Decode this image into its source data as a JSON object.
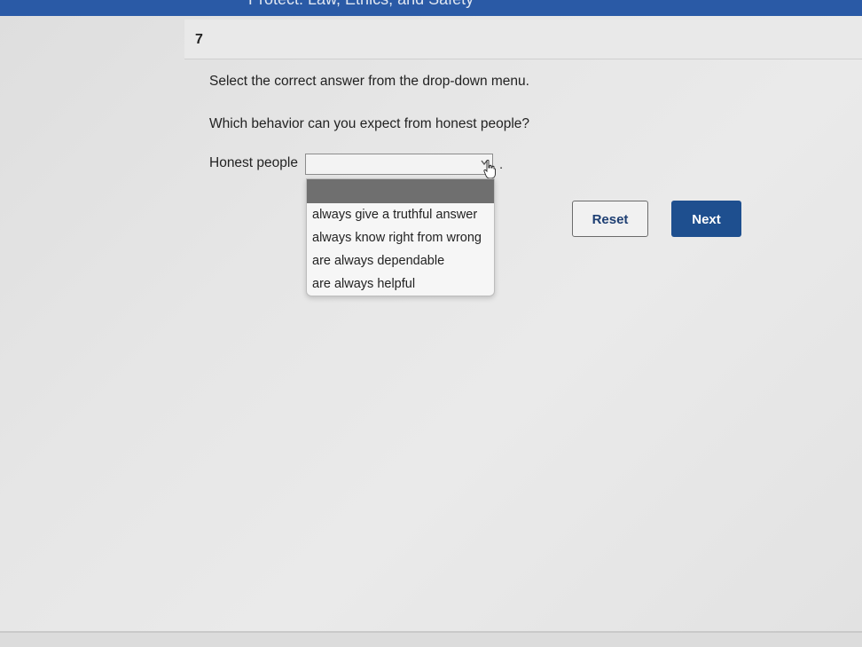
{
  "header": {
    "course_title": "Protect: Law, Ethics, and Safety",
    "bar_color": "#2a5aa6"
  },
  "question": {
    "number": "7",
    "instruction": "Select the correct answer from the drop-down menu.",
    "prompt": "Which behavior can you expect from honest people?",
    "sentence_start": "Honest people",
    "sentence_end": ".",
    "selected_value": ""
  },
  "dropdown": {
    "options": [
      "",
      "always give a truthful answer",
      "always know right from wrong",
      "are always dependable",
      "are always helpful"
    ],
    "highlighted_index": 0
  },
  "buttons": {
    "reset_label": "Reset",
    "next_label": "Next",
    "accent_color": "#1e4f8f"
  },
  "icons": {
    "dropdown": "chevron-down-icon",
    "pointer": "hand-cursor-icon"
  }
}
